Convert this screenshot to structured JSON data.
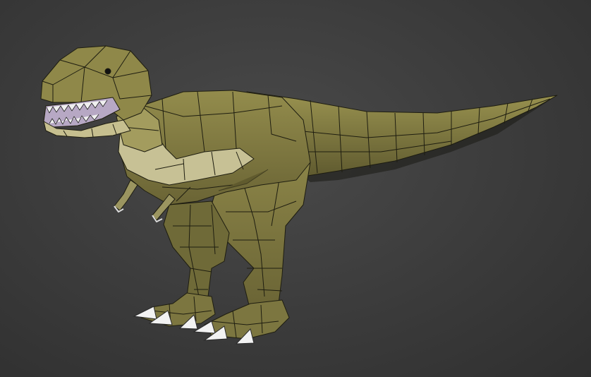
{
  "scene": {
    "subject": "trex-model",
    "colors": {
      "background": "#3c3c3c",
      "skin_base": "#8b8448",
      "skin_dark": "#5e5a2e",
      "skin_shadow": "#4a4624",
      "belly_light": "#c9c397",
      "mouth": "#b7a8c4",
      "claw": "#f2f2f2",
      "wireframe": "#1e1d10"
    }
  }
}
